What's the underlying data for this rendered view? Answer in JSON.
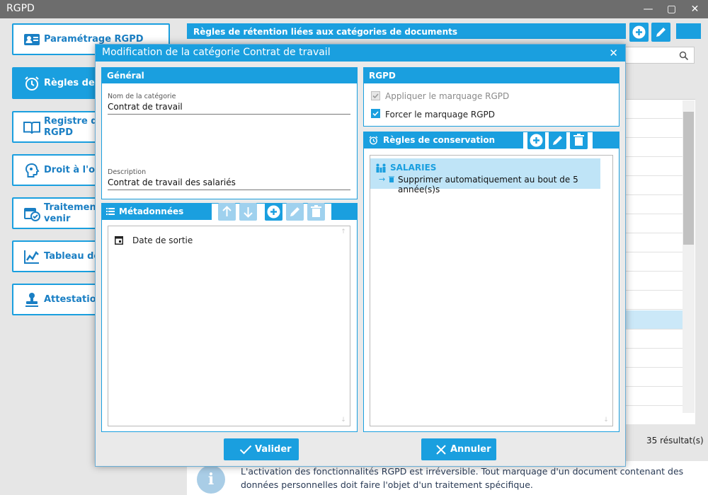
{
  "window": {
    "title": "RGPD",
    "minimize": "—",
    "maximize": "▢",
    "close": "✕"
  },
  "sidebar": {
    "items": [
      {
        "label": "Paramétrage RGPD",
        "icon": "id-card-icon",
        "active": false
      },
      {
        "label": "Règles de c",
        "icon": "alarm-clock-icon",
        "active": true
      },
      {
        "label_line1": "Registre des",
        "label_line2": "RGPD",
        "icon": "book-icon",
        "active": false
      },
      {
        "label": "Droit à l'oub",
        "icon": "head-icon",
        "active": false
      },
      {
        "label_line1": "Traitements",
        "label_line2": "venir",
        "icon": "calendar-check-icon",
        "active": false
      },
      {
        "label": "Tableau de",
        "icon": "chart-icon",
        "active": false
      },
      {
        "label": "Attestation",
        "icon": "stamp-icon",
        "active": false
      }
    ]
  },
  "background": {
    "panel_title": "Règles de rétention liées aux catégories de documents",
    "result_count": "35 résultat(s)",
    "info_text": "L'activation des fonctionnalités RGPD est irréversible. Tout marquage d'un document contenant des données personnelles doit faire l'objet d'un traitement spécifique.",
    "info_icon": "i"
  },
  "modal": {
    "title": "Modification de la catégorie Contrat de travail",
    "close": "✕",
    "general": {
      "title": "Général",
      "name_label": "Nom de la catégorie",
      "name_value": "Contrat de travail",
      "desc_label": "Description",
      "desc_value": "Contrat de travail des salariés"
    },
    "metadata": {
      "title": "Métadonnées",
      "items": [
        {
          "label": "Date de sortie",
          "icon": "calendar-icon"
        }
      ]
    },
    "rgpd": {
      "title": "RGPD",
      "apply_label": "Appliquer le marquage RGPD",
      "apply_checked": true,
      "apply_disabled": true,
      "force_label": "Forcer le marquage RGPD",
      "force_checked": true
    },
    "rules": {
      "title": "Règles de conservation",
      "items": [
        {
          "name": "SALARIES",
          "detail": "Supprimer automatiquement au bout de 5 année(s)s"
        }
      ]
    },
    "validate_label": "Valider",
    "cancel_label": "Annuler"
  },
  "colors": {
    "accent": "#1a9fdf",
    "accent_light": "#9fd1ee",
    "selection": "#bfe4f7",
    "titlebar": "#6d6d6d"
  }
}
